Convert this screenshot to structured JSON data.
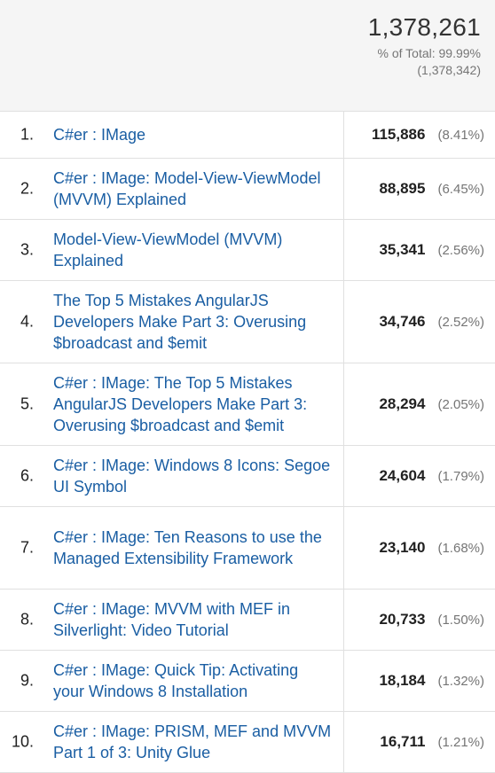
{
  "total": {
    "value": "1,378,261",
    "pct_label": "% of Total: 99.99%",
    "sub": "(1,378,342)"
  },
  "rows": [
    {
      "rank": "1.",
      "title": "C#er : IMage",
      "value": "115,886",
      "pct": "(8.41%)"
    },
    {
      "rank": "2.",
      "title": "C#er : IMage: Model-View-ViewModel (MVVM) Explained",
      "value": "88,895",
      "pct": "(6.45%)"
    },
    {
      "rank": "3.",
      "title": "Model-View-ViewModel (MVVM) Explained",
      "value": "35,341",
      "pct": "(2.56%)"
    },
    {
      "rank": "4.",
      "title": "The Top 5 Mistakes AngularJS Developers Make Part 3: Overusing $broadcast and $emit",
      "value": "34,746",
      "pct": "(2.52%)"
    },
    {
      "rank": "5.",
      "title": "C#er : IMage: The Top 5 Mistakes AngularJS Developers Make Part 3: Overusing $broadcast and $emit",
      "value": "28,294",
      "pct": "(2.05%)"
    },
    {
      "rank": "6.",
      "title": "C#er : IMage: Windows 8 Icons: Segoe UI Symbol",
      "value": "24,604",
      "pct": "(1.79%)"
    },
    {
      "rank": "7.",
      "title": "C#er : IMage: Ten Reasons to use the Managed Extensibility Framework",
      "value": "23,140",
      "pct": "(1.68%)"
    },
    {
      "rank": "8.",
      "title": "C#er : IMage: MVVM with MEF in Silverlight: Video Tutorial",
      "value": "20,733",
      "pct": "(1.50%)"
    },
    {
      "rank": "9.",
      "title": "C#er : IMage: Quick Tip: Activating your Windows 8 Installation",
      "value": "18,184",
      "pct": "(1.32%)"
    },
    {
      "rank": "10.",
      "title": "C#er : IMage: PRISM, MEF and MVVM Part 1 of 3: Unity Glue",
      "value": "16,711",
      "pct": "(1.21%)"
    }
  ]
}
